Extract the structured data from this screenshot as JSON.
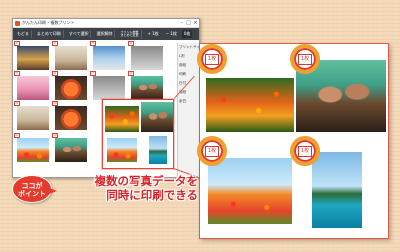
{
  "window": {
    "title": "かんたん印刷 – 複数プリント",
    "min_glyph": "–",
    "max_glyph": "□",
    "close_glyph": "×"
  },
  "toolbar": {
    "items": [
      "もどる",
      "まとめて印刷",
      "すべて選択",
      "選択解除",
      "プリント枚数 まとめて変更",
      "+ 1枚",
      "− 1枚",
      "0枚"
    ]
  },
  "side_panel": {
    "items": [
      "プリントサイズ",
      "L判",
      "用紙",
      "印刷",
      "日付",
      "用紙",
      "余白"
    ]
  },
  "grid": {
    "numbers": [
      "1",
      "2",
      "3",
      "4",
      "5",
      "6",
      "7",
      "8",
      "9",
      "10",
      "11",
      "12"
    ]
  },
  "preview": {
    "stamp_labels": [
      "1枚",
      "1枚",
      "1枚",
      "1枚"
    ]
  },
  "callout": {
    "line1": "ココが",
    "line2": "ポイント"
  },
  "headline": {
    "line1": "複数の写真データを",
    "line2": "同時に印刷できる"
  },
  "colors": {
    "accent": "#d9232a",
    "badge_ring": "#f0a030",
    "toolbar": "#3d4248"
  }
}
